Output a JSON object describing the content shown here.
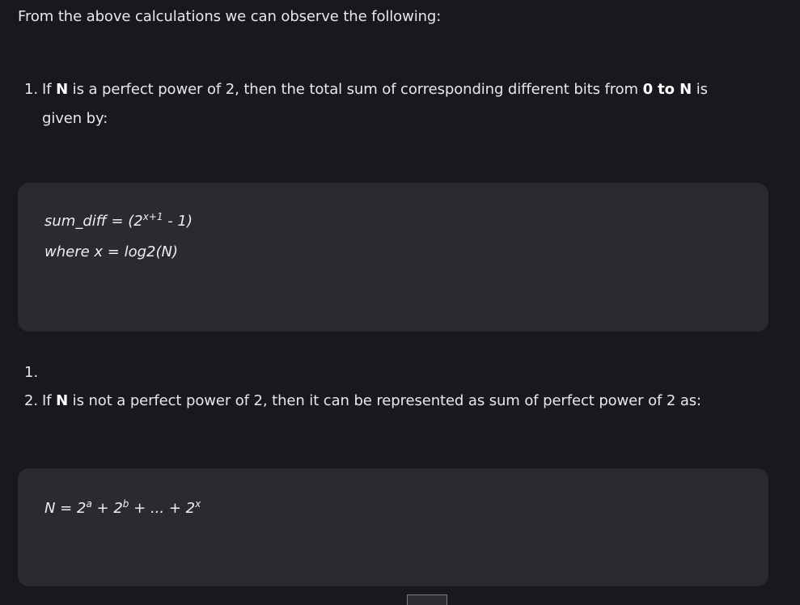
{
  "intro": "From the above calculations we can observe the following:",
  "item1": {
    "number": "1.",
    "pre": "If ",
    "n": "N",
    "mid": " is a perfect power of 2, then the total sum of corresponding different bits from ",
    "range": "0 to N",
    "post": " is",
    "cont": "given by:"
  },
  "formula1": {
    "line1_pre": "sum_diff = (2",
    "line1_exp": "x+1",
    "line1_post": " - 1)",
    "line2": "where x = log2(N)"
  },
  "empty_marker": "1.",
  "item2": {
    "number": "2.",
    "pre": "If ",
    "n": "N",
    "post": " is not a perfect power of 2, then it can be represented as sum of perfect power of 2 as:"
  },
  "formula2": {
    "p1": "N = 2",
    "e1": "a",
    "p2": " + 2",
    "e2": "b",
    "p3": " + ... + 2",
    "e3": "x"
  }
}
